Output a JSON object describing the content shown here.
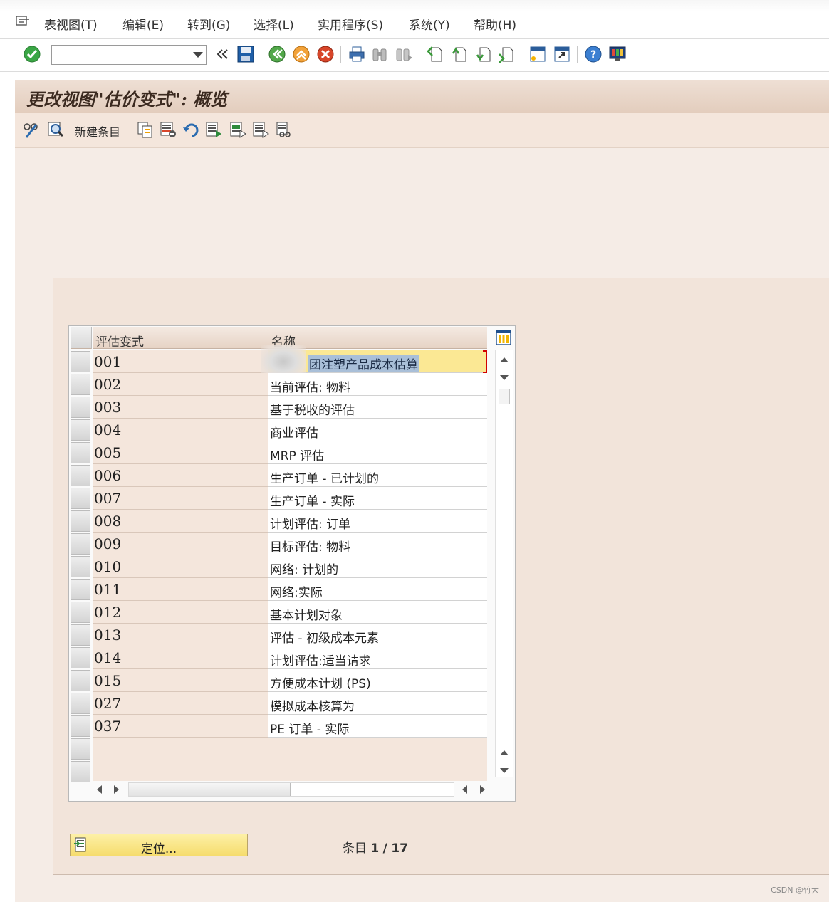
{
  "menu": {
    "items": [
      {
        "label": "表视图(T)"
      },
      {
        "label": "编辑(E)"
      },
      {
        "label": "转到(G)"
      },
      {
        "label": "选择(L)"
      },
      {
        "label": "实用程序(S)"
      },
      {
        "label": "系统(Y)"
      },
      {
        "label": "帮助(H)"
      }
    ]
  },
  "toolbar": {
    "command_value": ""
  },
  "title": "更改视图\"估价变式\": 概览",
  "app_toolbar": {
    "new_entries_label": "新建条目"
  },
  "table": {
    "columns": [
      "评估变式",
      "名称"
    ],
    "rows": [
      {
        "key": "001",
        "name": "团注塑产品成本估算"
      },
      {
        "key": "002",
        "name": "当前评估: 物料"
      },
      {
        "key": "003",
        "name": "基于税收的评估"
      },
      {
        "key": "004",
        "name": "商业评估"
      },
      {
        "key": "005",
        "name": "MRP 评估"
      },
      {
        "key": "006",
        "name": "生产订单 - 已计划的"
      },
      {
        "key": "007",
        "name": "生产订单 - 实际"
      },
      {
        "key": "008",
        "name": "计划评估: 订单"
      },
      {
        "key": "009",
        "name": "目标评估: 物料"
      },
      {
        "key": "010",
        "name": "网络: 计划的"
      },
      {
        "key": "011",
        "name": "网络:实际"
      },
      {
        "key": "012",
        "name": "基本计划对象"
      },
      {
        "key": "013",
        "name": "评估 - 初级成本元素"
      },
      {
        "key": "014",
        "name": "计划评估:适当请求"
      },
      {
        "key": "015",
        "name": "方便成本计划 (PS)"
      },
      {
        "key": "027",
        "name": "模拟成本核算为"
      },
      {
        "key": "037",
        "name": "PE 订单 - 实际"
      },
      {
        "key": "",
        "name": ""
      },
      {
        "key": "",
        "name": ""
      }
    ]
  },
  "bottom": {
    "locate_label": "定位...",
    "entry_prefix": "条目",
    "entry_current": "1",
    "entry_sep": "/",
    "entry_total": "17"
  },
  "watermark": "CSDN @竹大",
  "colors": {
    "title_band": "#e3cdbd",
    "content_bg": "#f5ece6",
    "selected_cell": "#fbe894",
    "text_selection": "#a9bfd8",
    "focus_marker": "#d20000"
  },
  "icons": [
    "menu-icon",
    "enter-check-icon",
    "back-icon",
    "save-icon",
    "back-green-icon",
    "exit-icon",
    "cancel-icon",
    "print-icon",
    "find-icon",
    "find-next-icon",
    "first-page-icon",
    "previous-page-icon",
    "next-page-icon",
    "last-page-icon",
    "new-session-icon",
    "shortcut-icon",
    "help-icon",
    "layout-menu-icon"
  ]
}
